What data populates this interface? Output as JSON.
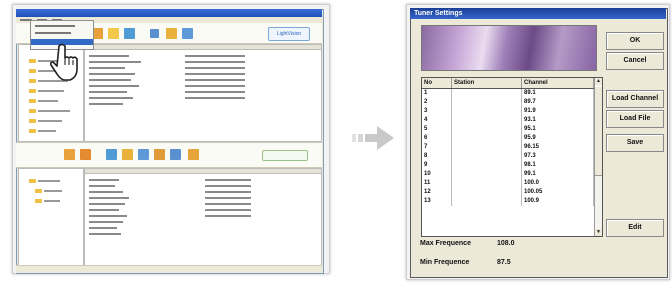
{
  "left_screenshot": {
    "window_title": "",
    "logo_text": "LightVision"
  },
  "dialog": {
    "title": "Tuner Settings",
    "columns": [
      "No",
      "Station",
      "Channel"
    ],
    "rows": [
      {
        "no": "1",
        "station": "",
        "channel": "89.1"
      },
      {
        "no": "2",
        "station": "",
        "channel": "89.7"
      },
      {
        "no": "3",
        "station": "",
        "channel": "91.9"
      },
      {
        "no": "4",
        "station": "",
        "channel": "93.1"
      },
      {
        "no": "5",
        "station": "",
        "channel": "95.1"
      },
      {
        "no": "6",
        "station": "",
        "channel": "95.9"
      },
      {
        "no": "7",
        "station": "",
        "channel": "96.15"
      },
      {
        "no": "8",
        "station": "",
        "channel": "97.3"
      },
      {
        "no": "9",
        "station": "",
        "channel": "98.1"
      },
      {
        "no": "10",
        "station": "",
        "channel": "99.1"
      },
      {
        "no": "11",
        "station": "",
        "channel": "100.0"
      },
      {
        "no": "12",
        "station": "",
        "channel": "100.05"
      },
      {
        "no": "13",
        "station": "",
        "channel": "100.9"
      }
    ],
    "buttons": {
      "ok": "OK",
      "cancel": "Cancel",
      "load_channel": "Load Channel",
      "load_file": "Load File",
      "save": "Save",
      "edit": "Edit"
    },
    "max_frequence_label": "Max Frequence",
    "max_frequence_value": "108.0",
    "min_frequence_label": "Min Frequence",
    "min_frequence_value": "87.5"
  },
  "colors": {
    "title_bar": "#1f4fb8",
    "selection": "#316ac5",
    "dialog_face": "#ece9d8",
    "arrow": "#c9c9c9"
  }
}
